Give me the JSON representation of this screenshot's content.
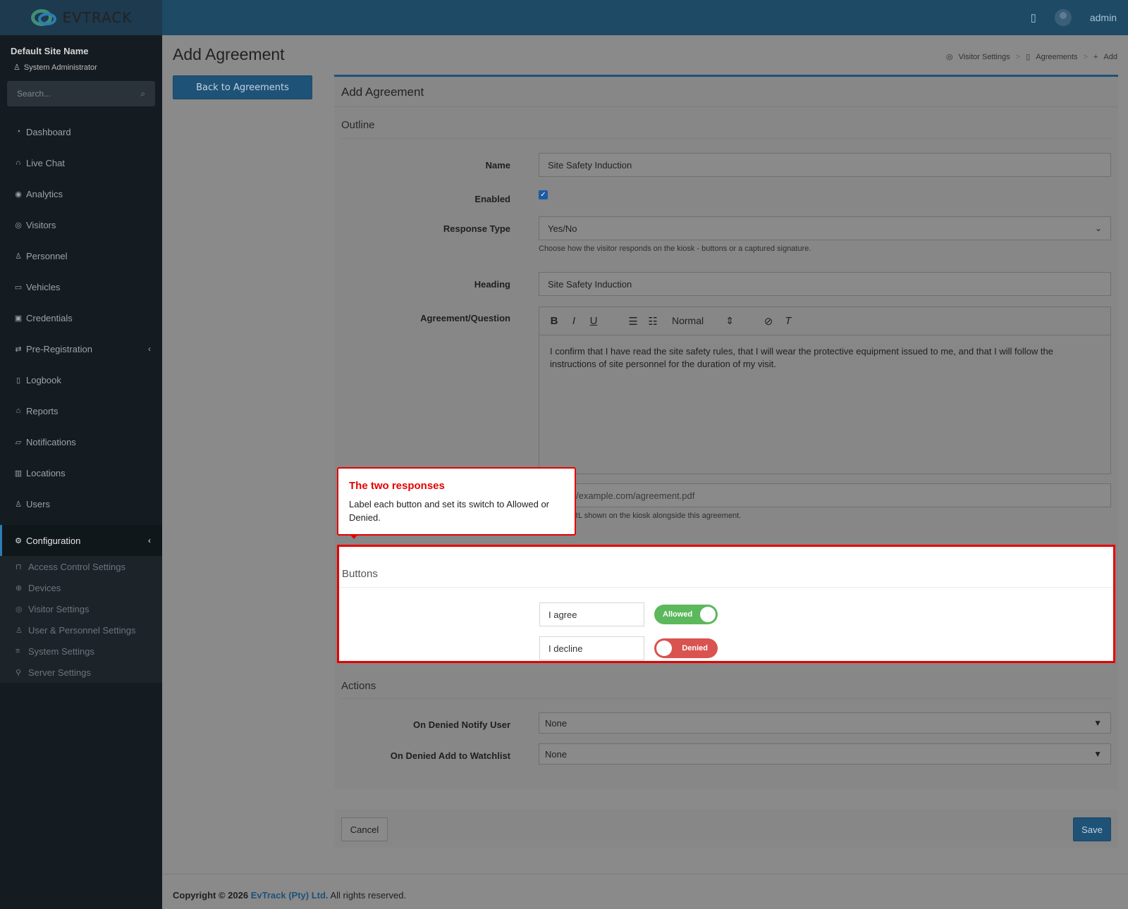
{
  "app": {
    "logo_text": "EVTRACK",
    "user_name": "admin"
  },
  "sidebar": {
    "site_name": "Default Site Name",
    "role": "System Administrator",
    "search_placeholder": "Search...",
    "items": [
      {
        "label": "Dashboard",
        "icon": "dashboard-icon"
      },
      {
        "label": "Live Chat",
        "icon": "headset-icon"
      },
      {
        "label": "Analytics",
        "icon": "target-icon"
      },
      {
        "label": "Visitors",
        "icon": "eye-icon"
      },
      {
        "label": "Personnel",
        "icon": "user-gear-icon"
      },
      {
        "label": "Vehicles",
        "icon": "car-icon"
      },
      {
        "label": "Credentials",
        "icon": "badge-icon"
      },
      {
        "label": "Pre-Registration",
        "icon": "swap-icon"
      },
      {
        "label": "Logbook",
        "icon": "book-icon"
      },
      {
        "label": "Reports",
        "icon": "chart-icon"
      },
      {
        "label": "Notifications",
        "icon": "chat-icon"
      },
      {
        "label": "Locations",
        "icon": "map-icon"
      },
      {
        "label": "Users",
        "icon": "users-icon"
      }
    ],
    "active": {
      "label": "Configuration",
      "icon": "gear-icon"
    },
    "subitems": [
      {
        "label": "Access Control Settings",
        "icon": "lock-icon"
      },
      {
        "label": "Devices",
        "icon": "devices-icon"
      },
      {
        "label": "Visitor Settings",
        "icon": "eye-icon"
      },
      {
        "label": "User & Personnel Settings",
        "icon": "users-icon"
      },
      {
        "label": "System Settings",
        "icon": "sliders-icon"
      },
      {
        "label": "Server Settings",
        "icon": "server-icon"
      }
    ]
  },
  "header": {
    "page_title": "Add Agreement",
    "breadcrumb": [
      "Visitor Settings",
      "Agreements",
      "Add"
    ],
    "back_button": "Back to Agreements"
  },
  "form": {
    "card_title": "Add Agreement",
    "outline_title": "Outline",
    "name_label": "Name",
    "name_value": "Site Safety Induction",
    "enabled_label": "Enabled",
    "enabled": true,
    "response_type_label": "Response Type",
    "response_type_value": "Yes/No",
    "response_type_help": "Choose how the visitor responds on the kiosk - buttons or a captured signature.",
    "heading_label": "Heading",
    "heading_value": "Site Safety Induction",
    "question_label": "Agreement/Question",
    "editor_format": "Normal",
    "question_text": "I confirm that I have read the site safety rules, that I will wear the protective equipment issued to me, and that I will follow the instructions of site personnel for the duration of my visit.",
    "url_placeholder_visible": "/example.com/agreement.pdf",
    "url_help_visible": "RL shown on the kiosk alongside this agreement.",
    "buttons_title": "Buttons",
    "responses": [
      {
        "label": "I agree",
        "state": "Allowed"
      },
      {
        "label": "I decline",
        "state": "Denied"
      }
    ],
    "actions_title": "Actions",
    "notify_label": "On Denied Notify User",
    "notify_value": "None",
    "watchlist_label": "On Denied Add to Watchlist",
    "watchlist_value": "None",
    "cancel_label": "Cancel",
    "save_label": "Save"
  },
  "callout": {
    "title": "The two responses",
    "text": "Label each button and set its switch to Allowed or Denied."
  },
  "footer": {
    "prefix": "Copyright © 2026",
    "company": "EvTrack (Pty) Ltd.",
    "suffix": "All rights reserved."
  },
  "colors": {
    "accent": "#1f5277",
    "highlight": "#e60000",
    "allowed": "#5cb85c",
    "denied": "#d9534f"
  }
}
